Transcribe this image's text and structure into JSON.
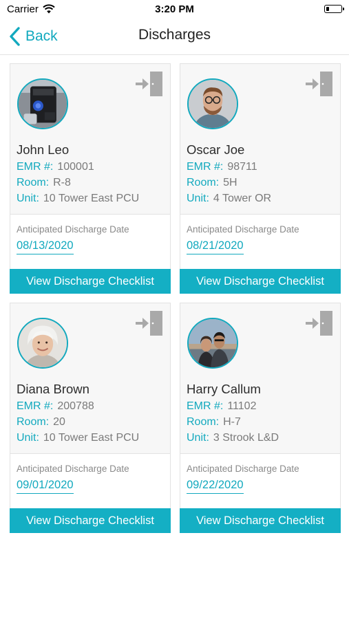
{
  "status_bar": {
    "carrier": "Carrier",
    "time": "3:20 PM",
    "battery_level": 0.2
  },
  "nav": {
    "back_label": "Back",
    "title": "Discharges"
  },
  "colors": {
    "accent": "#14afc4",
    "label": "#12a9be",
    "value_gray": "#7a7a7a",
    "icon_gray": "#a9a9a9"
  },
  "labels": {
    "emr": "EMR #:",
    "room": "Room:",
    "unit": "Unit:",
    "anticipated_date": "Anticipated Discharge Date",
    "checklist_button": "View Discharge Checklist"
  },
  "patients": [
    {
      "name": "John Leo",
      "emr": "100001",
      "room": "R-8",
      "unit": "10 Tower East PCU",
      "discharge_date": "08/13/2020",
      "avatar_icon": "coffee-machine-photo"
    },
    {
      "name": "Oscar Joe",
      "emr": "98711",
      "room": "5H",
      "unit": "4 Tower OR",
      "discharge_date": "08/21/2020",
      "avatar_icon": "man-with-glasses-photo"
    },
    {
      "name": "Diana Brown",
      "emr": "200788",
      "room": "20",
      "unit": "10 Tower East PCU",
      "discharge_date": "09/01/2020",
      "avatar_icon": "elderly-woman-photo"
    },
    {
      "name": "Harry Callum",
      "emr": "11102",
      "room": "H-7",
      "unit": "3 Strook L&D",
      "discharge_date": "09/22/2020",
      "avatar_icon": "couple-photo"
    }
  ]
}
